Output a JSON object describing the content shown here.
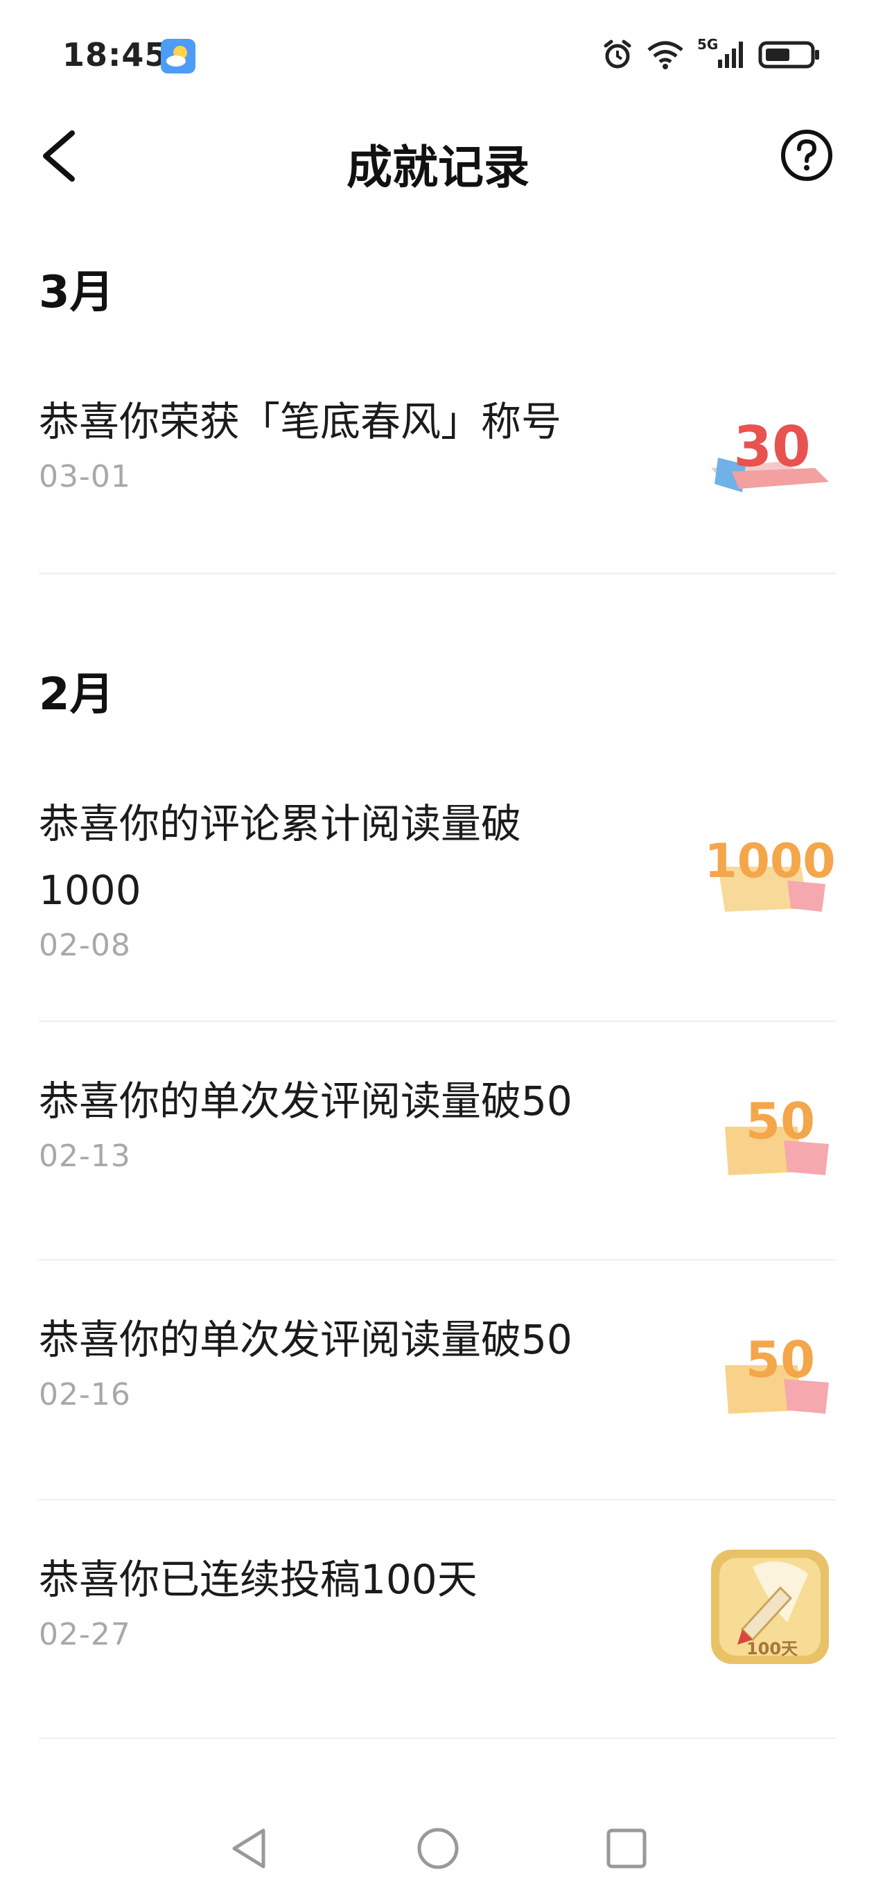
{
  "status_bar": {
    "time": "18:45",
    "network": "5G"
  },
  "header": {
    "title": "成就记录"
  },
  "sections": [
    {
      "month": "3月",
      "records": [
        {
          "title": "恭喜你荣获「笔底春风」称号",
          "date": "03-01",
          "badge_text": "30",
          "badge_icon": "badge-30-icon"
        }
      ]
    },
    {
      "month": "2月",
      "records": [
        {
          "title": "恭喜你的评论累计阅读量破1000",
          "date": "02-08",
          "badge_text": "1000",
          "badge_icon": "badge-1000-icon"
        },
        {
          "title": "恭喜你的单次发评阅读量破50",
          "date": "02-13",
          "badge_text": "50",
          "badge_icon": "badge-50-icon"
        },
        {
          "title": "恭喜你的单次发评阅读量破50",
          "date": "02-16",
          "badge_text": "50",
          "badge_icon": "badge-50-icon"
        },
        {
          "title": "恭喜你已连续投稿100天",
          "date": "02-27",
          "badge_text": "100天",
          "badge_icon": "badge-100-days-pen-icon"
        }
      ]
    }
  ],
  "colors": {
    "badge_red": "#e8524f",
    "badge_orange": "#f4a64a",
    "badge_gold": "#e9c167",
    "date_gray": "#a8a8a8"
  }
}
